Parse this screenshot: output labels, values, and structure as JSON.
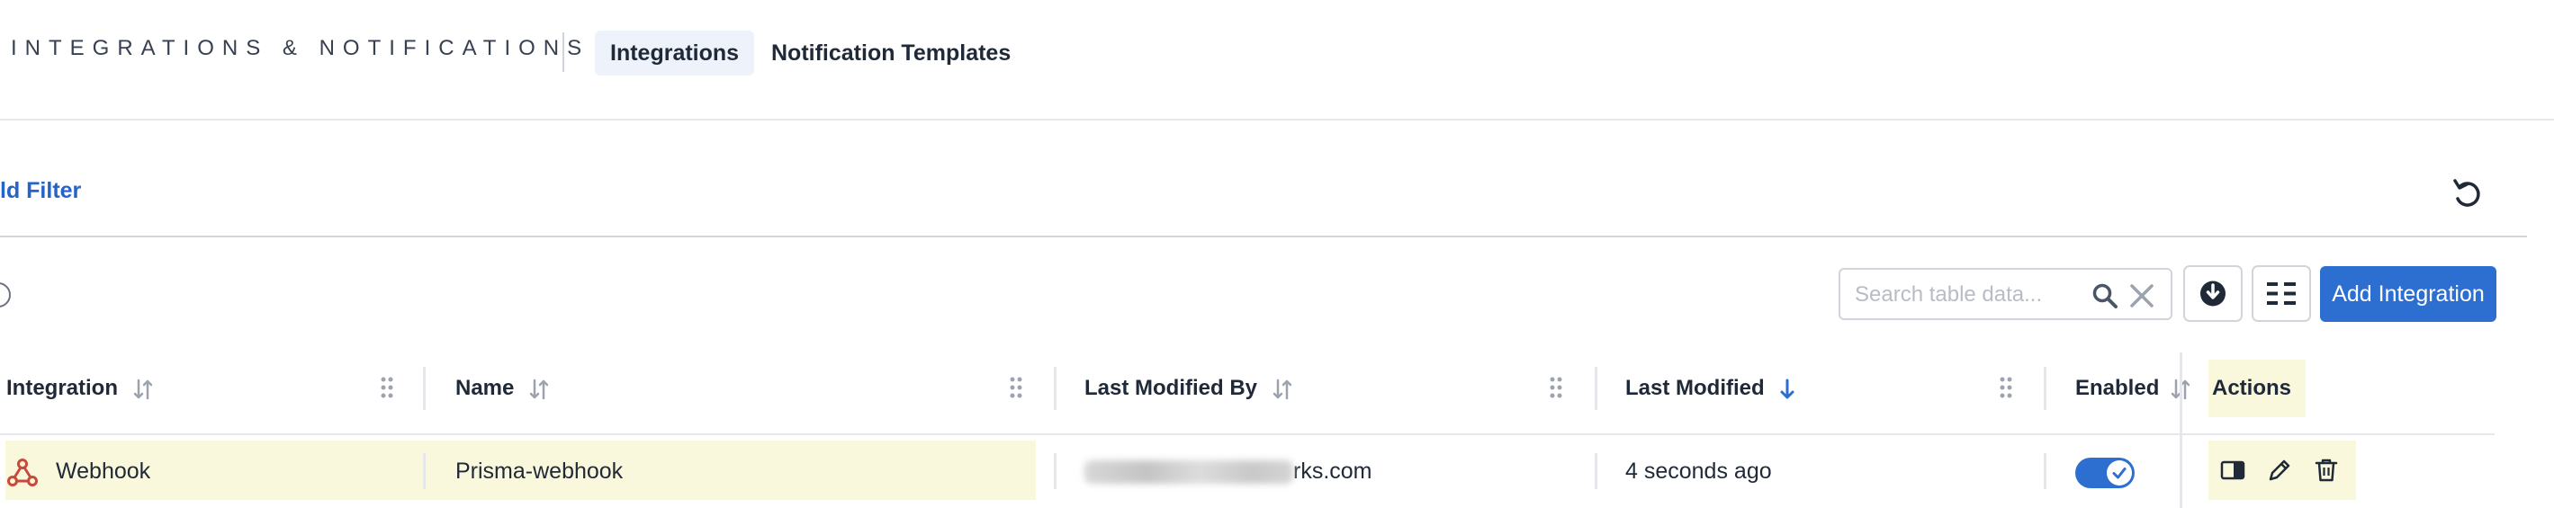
{
  "header": {
    "title": "INTEGRATIONS & NOTIFICATIONS",
    "tabs": [
      {
        "label": "Integrations",
        "active": true
      },
      {
        "label": "Notification Templates",
        "active": false
      }
    ]
  },
  "filters": {
    "add_filter_label": "ld Filter",
    "reset_icon": "reset-icon"
  },
  "toolbar": {
    "search_placeholder": "Search table data...",
    "add_button_label": "Add Integration",
    "icons": [
      "search-icon",
      "clear-icon",
      "download-icon",
      "columns-icon"
    ]
  },
  "table": {
    "columns": [
      {
        "label": "Integration",
        "sort": "none"
      },
      {
        "label": "Name",
        "sort": "none"
      },
      {
        "label": "Last Modified By",
        "sort": "none"
      },
      {
        "label": "Last Modified",
        "sort": "desc"
      },
      {
        "label": "Enabled",
        "sort": "none"
      },
      {
        "label": "Actions"
      }
    ],
    "rows": [
      {
        "integration": "Webhook",
        "name": "Prisma-webhook",
        "last_modified_by_visible": "rks.com",
        "last_modified": "4 seconds ago",
        "enabled": true
      }
    ]
  },
  "colors": {
    "accent": "#2d6fd1",
    "link": "#2563c9",
    "highlight": "#faf8dc",
    "active_tab_bg": "#eef3fb",
    "webhook_icon": "#c94a3b"
  }
}
